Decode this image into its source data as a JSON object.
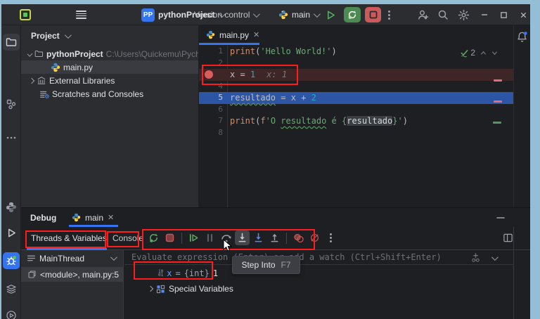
{
  "icons": {
    "binary_top": "10",
    "binary_bottom": "01"
  },
  "colors": {
    "accent": "#3574f0",
    "annotation_red": "#fd1d1d",
    "exec_line": "#2d55a5",
    "breakpoint_line": "#3f2626",
    "breakpoint": "#db5c5c",
    "run_green": "#5fad65",
    "stop_red": "#c75450",
    "string_green": "#6aab73",
    "number_teal": "#2aacb8",
    "keyword_tan": "#cf8e6d"
  },
  "titlebar": {
    "project_badge": "PP",
    "project_name": "pythonProject",
    "version_control": "Version control",
    "run_config": "main"
  },
  "project_panel": {
    "header": "Project",
    "root_label": "pythonProject",
    "root_path": "C:\\Users\\Quickemu\\Pycharm",
    "file": "main.py",
    "external_libs": "External Libraries",
    "scratches": "Scratches and Consoles"
  },
  "editor": {
    "tab": "main.py",
    "inspections_count": "2",
    "lines": [
      {
        "tokens": [
          {
            "t": "print",
            "c": "fn"
          },
          {
            "t": "(",
            "c": "p"
          },
          {
            "t": "'Hello World!'",
            "c": "str"
          },
          {
            "t": ")",
            "c": "p"
          }
        ]
      },
      {
        "tokens": []
      },
      {
        "row": "bp-line",
        "bp": true,
        "tokens": [
          {
            "t": "x",
            "c": "v"
          },
          {
            "t": " = ",
            "c": "p"
          },
          {
            "t": "1",
            "c": "num"
          },
          {
            "t": "x: 1",
            "c": "hint"
          }
        ]
      },
      {
        "tokens": []
      },
      {
        "row": "exec-line",
        "tokens": [
          {
            "t": "resultado",
            "c": "v u"
          },
          {
            "t": " = ",
            "c": "p"
          },
          {
            "t": "x",
            "c": "v"
          },
          {
            "t": " + ",
            "c": "p"
          },
          {
            "t": "2",
            "c": "num"
          }
        ]
      },
      {
        "tokens": []
      },
      {
        "tokens": [
          {
            "t": "print",
            "c": "fn"
          },
          {
            "t": "(",
            "c": "p"
          },
          {
            "t": "f",
            "c": "fn"
          },
          {
            "t": "'O ",
            "c": "str"
          },
          {
            "t": "resultado",
            "c": "str u"
          },
          {
            "t": " é ",
            "c": "str"
          },
          {
            "t": "{",
            "c": "str"
          },
          {
            "t": "resultado",
            "c": "ref"
          },
          {
            "t": "}",
            "c": "str"
          },
          {
            "t": "'",
            "c": "str"
          },
          {
            "t": ")",
            "c": "p"
          }
        ]
      },
      {
        "tokens": []
      }
    ]
  },
  "debug_panel": {
    "title": "Debug",
    "session_tab": "main",
    "tab_threads": "Threads & Variables",
    "tab_console": "Console",
    "thread": "MainThread",
    "frame": "<module>, main.py:5",
    "evaluate_placeholder": "Evaluate expression (Enter) or add a watch (Ctrl+Shift+Enter)",
    "variable": {
      "name": "x",
      "eq": "=",
      "type": "{int}",
      "value": "1"
    },
    "special_variables": "Special Variables",
    "toolbar_icons": [
      "rerun",
      "stop",
      "resume",
      "pause",
      "step-over",
      "step-into",
      "force-step-into",
      "step-out",
      "view-breakpoints",
      "mute-breakpoints",
      "more"
    ]
  },
  "tooltip": {
    "label": "Step Into",
    "shortcut": "F7"
  }
}
